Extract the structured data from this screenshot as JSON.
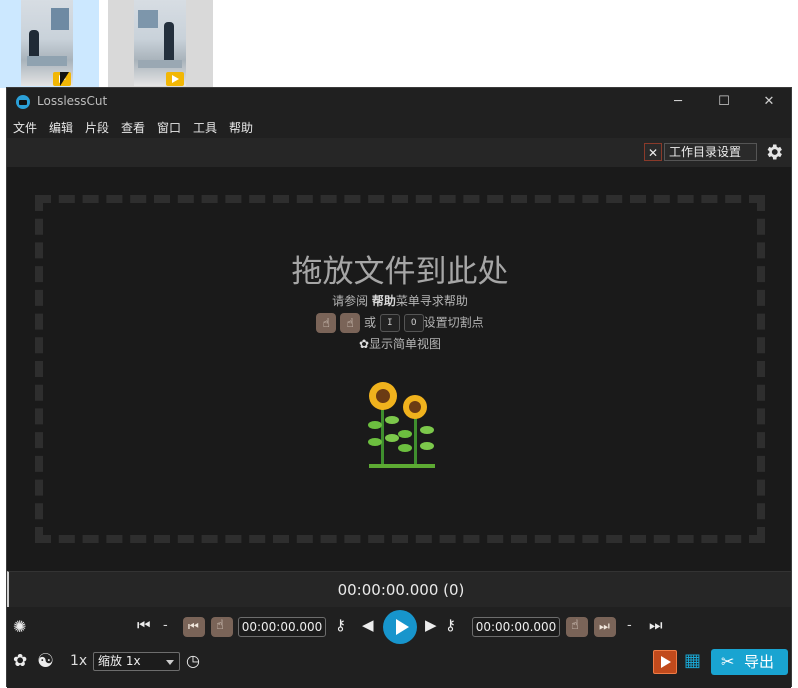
{
  "window": {
    "title": "LosslessCut"
  },
  "menu": [
    "文件",
    "编辑",
    "片段",
    "查看",
    "窗口",
    "工具",
    "帮助"
  ],
  "topbar": {
    "close_label": "✕",
    "working_dir_label": "工作目录设置"
  },
  "dropzone": {
    "title": "拖放文件到此处",
    "help_prefix": "请参阅 ",
    "help_bold": "帮助",
    "help_suffix": "菜单寻求帮助",
    "cut_or": "或",
    "key_in": "I",
    "key_out": "O",
    "cut_suffix": "设置切割点",
    "simple_view": "显示简单视图"
  },
  "timeline": {
    "current_time": "00:00:00.000 (0)"
  },
  "controls": {
    "start_dash": "-",
    "cut_start_time": "00:00:00.000",
    "cut_end_time": "00:00:00.000",
    "end_dash": "-",
    "speed": "1x",
    "zoom": "缩放 1x",
    "export_label": "导出"
  },
  "colors": {
    "accent": "#1795cc",
    "export": "#19a4d1",
    "cut_button": "#7a6458",
    "record": "#d4501e"
  }
}
